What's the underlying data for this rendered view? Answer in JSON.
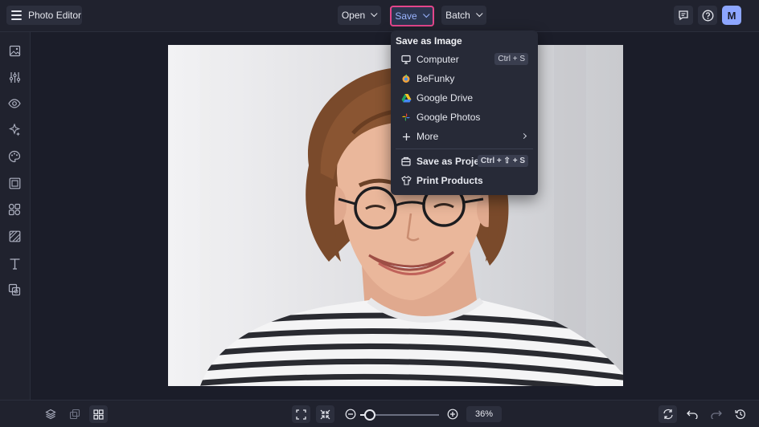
{
  "topbar": {
    "app_title": "Photo Editor",
    "open_label": "Open",
    "save_label": "Save",
    "batch_label": "Batch",
    "avatar_initial": "M"
  },
  "save_menu": {
    "header": "Save as Image",
    "items": [
      {
        "label": "Computer",
        "icon": "monitor-icon",
        "shortcut": "Ctrl + S"
      },
      {
        "label": "BeFunky",
        "icon": "befunky-icon"
      },
      {
        "label": "Google Drive",
        "icon": "google-drive-icon"
      },
      {
        "label": "Google Photos",
        "icon": "google-photos-icon"
      },
      {
        "label": "More",
        "icon": "plus-icon"
      },
      {
        "label": "Save as Project",
        "icon": "project-icon",
        "shortcut": "Ctrl + ⇧ + S"
      },
      {
        "label": "Print Products",
        "icon": "shirt-icon"
      }
    ]
  },
  "sidebar": {
    "tools": [
      "image-icon",
      "adjust-icon",
      "eye-icon",
      "effects-icon",
      "paint-icon",
      "frame-icon",
      "shapes-icon",
      "texture-icon",
      "text-icon",
      "graphics-icon"
    ]
  },
  "bottombar": {
    "zoom": "36%",
    "zoom_fraction": 0.12
  },
  "colors": {
    "accent_highlight": "#e3468b",
    "save_text": "#9ab4ff",
    "avatar_bg": "#8da6ff",
    "background": "#1b1d29"
  }
}
